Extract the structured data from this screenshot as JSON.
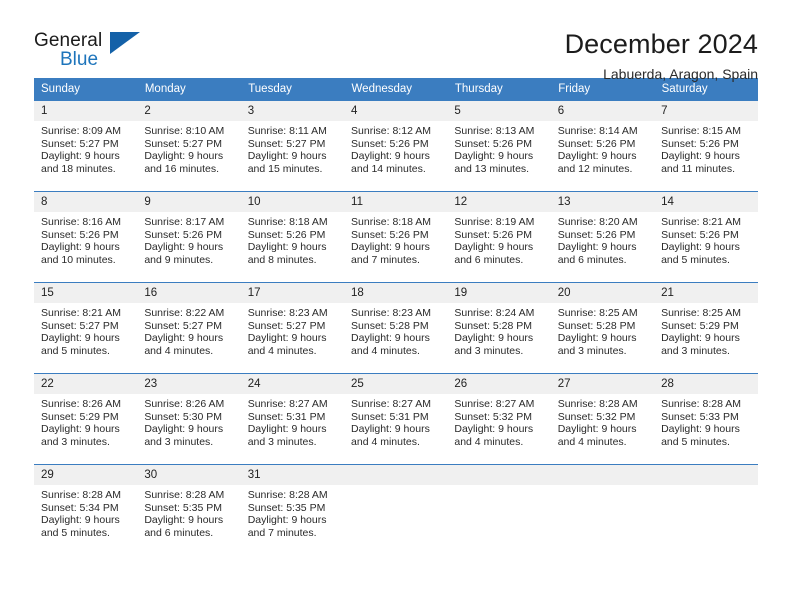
{
  "brand": {
    "name_line1": "General",
    "name_line2": "Blue",
    "flag_color": "#1461a8",
    "blue_text_color": "#1d74bb"
  },
  "header": {
    "title": "December 2024",
    "subtitle": "Labuerda, Aragon, Spain"
  },
  "theme": {
    "header_bg": "#3b7dc0",
    "daynum_bg": "#f0f0f0",
    "text": "#222222"
  },
  "weekdays": [
    "Sunday",
    "Monday",
    "Tuesday",
    "Wednesday",
    "Thursday",
    "Friday",
    "Saturday"
  ],
  "weeks": [
    [
      {
        "day": "1",
        "sunrise": "Sunrise: 8:09 AM",
        "sunset": "Sunset: 5:27 PM",
        "daylight1": "Daylight: 9 hours",
        "daylight2": "and 18 minutes."
      },
      {
        "day": "2",
        "sunrise": "Sunrise: 8:10 AM",
        "sunset": "Sunset: 5:27 PM",
        "daylight1": "Daylight: 9 hours",
        "daylight2": "and 16 minutes."
      },
      {
        "day": "3",
        "sunrise": "Sunrise: 8:11 AM",
        "sunset": "Sunset: 5:27 PM",
        "daylight1": "Daylight: 9 hours",
        "daylight2": "and 15 minutes."
      },
      {
        "day": "4",
        "sunrise": "Sunrise: 8:12 AM",
        "sunset": "Sunset: 5:26 PM",
        "daylight1": "Daylight: 9 hours",
        "daylight2": "and 14 minutes."
      },
      {
        "day": "5",
        "sunrise": "Sunrise: 8:13 AM",
        "sunset": "Sunset: 5:26 PM",
        "daylight1": "Daylight: 9 hours",
        "daylight2": "and 13 minutes."
      },
      {
        "day": "6",
        "sunrise": "Sunrise: 8:14 AM",
        "sunset": "Sunset: 5:26 PM",
        "daylight1": "Daylight: 9 hours",
        "daylight2": "and 12 minutes."
      },
      {
        "day": "7",
        "sunrise": "Sunrise: 8:15 AM",
        "sunset": "Sunset: 5:26 PM",
        "daylight1": "Daylight: 9 hours",
        "daylight2": "and 11 minutes."
      }
    ],
    [
      {
        "day": "8",
        "sunrise": "Sunrise: 8:16 AM",
        "sunset": "Sunset: 5:26 PM",
        "daylight1": "Daylight: 9 hours",
        "daylight2": "and 10 minutes."
      },
      {
        "day": "9",
        "sunrise": "Sunrise: 8:17 AM",
        "sunset": "Sunset: 5:26 PM",
        "daylight1": "Daylight: 9 hours",
        "daylight2": "and 9 minutes."
      },
      {
        "day": "10",
        "sunrise": "Sunrise: 8:18 AM",
        "sunset": "Sunset: 5:26 PM",
        "daylight1": "Daylight: 9 hours",
        "daylight2": "and 8 minutes."
      },
      {
        "day": "11",
        "sunrise": "Sunrise: 8:18 AM",
        "sunset": "Sunset: 5:26 PM",
        "daylight1": "Daylight: 9 hours",
        "daylight2": "and 7 minutes."
      },
      {
        "day": "12",
        "sunrise": "Sunrise: 8:19 AM",
        "sunset": "Sunset: 5:26 PM",
        "daylight1": "Daylight: 9 hours",
        "daylight2": "and 6 minutes."
      },
      {
        "day": "13",
        "sunrise": "Sunrise: 8:20 AM",
        "sunset": "Sunset: 5:26 PM",
        "daylight1": "Daylight: 9 hours",
        "daylight2": "and 6 minutes."
      },
      {
        "day": "14",
        "sunrise": "Sunrise: 8:21 AM",
        "sunset": "Sunset: 5:26 PM",
        "daylight1": "Daylight: 9 hours",
        "daylight2": "and 5 minutes."
      }
    ],
    [
      {
        "day": "15",
        "sunrise": "Sunrise: 8:21 AM",
        "sunset": "Sunset: 5:27 PM",
        "daylight1": "Daylight: 9 hours",
        "daylight2": "and 5 minutes."
      },
      {
        "day": "16",
        "sunrise": "Sunrise: 8:22 AM",
        "sunset": "Sunset: 5:27 PM",
        "daylight1": "Daylight: 9 hours",
        "daylight2": "and 4 minutes."
      },
      {
        "day": "17",
        "sunrise": "Sunrise: 8:23 AM",
        "sunset": "Sunset: 5:27 PM",
        "daylight1": "Daylight: 9 hours",
        "daylight2": "and 4 minutes."
      },
      {
        "day": "18",
        "sunrise": "Sunrise: 8:23 AM",
        "sunset": "Sunset: 5:28 PM",
        "daylight1": "Daylight: 9 hours",
        "daylight2": "and 4 minutes."
      },
      {
        "day": "19",
        "sunrise": "Sunrise: 8:24 AM",
        "sunset": "Sunset: 5:28 PM",
        "daylight1": "Daylight: 9 hours",
        "daylight2": "and 3 minutes."
      },
      {
        "day": "20",
        "sunrise": "Sunrise: 8:25 AM",
        "sunset": "Sunset: 5:28 PM",
        "daylight1": "Daylight: 9 hours",
        "daylight2": "and 3 minutes."
      },
      {
        "day": "21",
        "sunrise": "Sunrise: 8:25 AM",
        "sunset": "Sunset: 5:29 PM",
        "daylight1": "Daylight: 9 hours",
        "daylight2": "and 3 minutes."
      }
    ],
    [
      {
        "day": "22",
        "sunrise": "Sunrise: 8:26 AM",
        "sunset": "Sunset: 5:29 PM",
        "daylight1": "Daylight: 9 hours",
        "daylight2": "and 3 minutes."
      },
      {
        "day": "23",
        "sunrise": "Sunrise: 8:26 AM",
        "sunset": "Sunset: 5:30 PM",
        "daylight1": "Daylight: 9 hours",
        "daylight2": "and 3 minutes."
      },
      {
        "day": "24",
        "sunrise": "Sunrise: 8:27 AM",
        "sunset": "Sunset: 5:31 PM",
        "daylight1": "Daylight: 9 hours",
        "daylight2": "and 3 minutes."
      },
      {
        "day": "25",
        "sunrise": "Sunrise: 8:27 AM",
        "sunset": "Sunset: 5:31 PM",
        "daylight1": "Daylight: 9 hours",
        "daylight2": "and 4 minutes."
      },
      {
        "day": "26",
        "sunrise": "Sunrise: 8:27 AM",
        "sunset": "Sunset: 5:32 PM",
        "daylight1": "Daylight: 9 hours",
        "daylight2": "and 4 minutes."
      },
      {
        "day": "27",
        "sunrise": "Sunrise: 8:28 AM",
        "sunset": "Sunset: 5:32 PM",
        "daylight1": "Daylight: 9 hours",
        "daylight2": "and 4 minutes."
      },
      {
        "day": "28",
        "sunrise": "Sunrise: 8:28 AM",
        "sunset": "Sunset: 5:33 PM",
        "daylight1": "Daylight: 9 hours",
        "daylight2": "and 5 minutes."
      }
    ],
    [
      {
        "day": "29",
        "sunrise": "Sunrise: 8:28 AM",
        "sunset": "Sunset: 5:34 PM",
        "daylight1": "Daylight: 9 hours",
        "daylight2": "and 5 minutes."
      },
      {
        "day": "30",
        "sunrise": "Sunrise: 8:28 AM",
        "sunset": "Sunset: 5:35 PM",
        "daylight1": "Daylight: 9 hours",
        "daylight2": "and 6 minutes."
      },
      {
        "day": "31",
        "sunrise": "Sunrise: 8:28 AM",
        "sunset": "Sunset: 5:35 PM",
        "daylight1": "Daylight: 9 hours",
        "daylight2": "and 7 minutes."
      },
      {
        "day": "",
        "sunrise": "",
        "sunset": "",
        "daylight1": "",
        "daylight2": ""
      },
      {
        "day": "",
        "sunrise": "",
        "sunset": "",
        "daylight1": "",
        "daylight2": ""
      },
      {
        "day": "",
        "sunrise": "",
        "sunset": "",
        "daylight1": "",
        "daylight2": ""
      },
      {
        "day": "",
        "sunrise": "",
        "sunset": "",
        "daylight1": "",
        "daylight2": ""
      }
    ]
  ]
}
